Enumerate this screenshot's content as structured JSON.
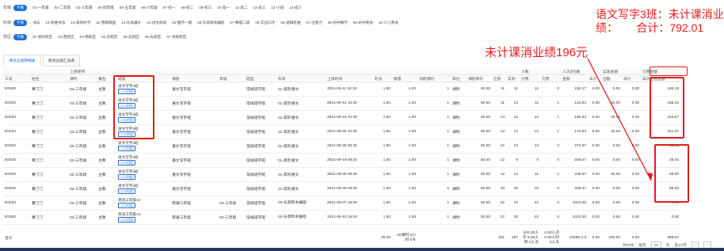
{
  "filters": [
    {
      "label": "年级:",
      "items": [
        "不限",
        "01-一年级",
        "02-二年级",
        "03-三年级",
        "04-四年级",
        "05-五年级",
        "06-六年级",
        "07-初一",
        "08-初二",
        "09-初三",
        "10-高一",
        "11-高二",
        "12-高三",
        "13-小班",
        "14-成人"
      ]
    },
    {
      "label": "科目:",
      "items": [
        "不限",
        "书法",
        "14-思维书法",
        "15-高效补学",
        "11-围棋棋盘",
        "13-乐高器片",
        "01-语文阅读",
        "02-国学一级",
        "03-乐高积木编程",
        "07-数理二级",
        "05-实战口才",
        "06-逻辑思维",
        "07-注意力",
        "08-初中数学",
        "09-初中英语",
        "10-少儿英语"
      ]
    },
    {
      "label": "校区:",
      "items": [
        "不限",
        "01-星科校区",
        "02-西校区",
        "03-南校区",
        "04-东校区",
        "05-北校区",
        "06-光校区",
        "07-洛阳校区"
      ]
    }
  ],
  "tabs": [
    "课消业绩明细表",
    "课消业绩汇总表"
  ],
  "headers_top": [
    "",
    "",
    "上课老师",
    "",
    "",
    "",
    "",
    "",
    "",
    "",
    "",
    "",
    "",
    "",
    "",
    "",
    "",
    "人数",
    "",
    "人次(时)数",
    "",
    "实收金额",
    "",
    "欠费金额",
    "",
    ""
  ],
  "headers": [
    "工号",
    "姓名",
    "课时",
    "角色",
    "班级",
    "课程",
    "年级",
    "班型",
    "科目",
    "上课时间",
    "时长",
    "数量",
    "消耗课时",
    "单位",
    "课程单价",
    "应到",
    "实到",
    "计费",
    "欠费",
    "金额",
    "未计",
    "出勤",
    "未计",
    "未计业绩金额"
  ],
  "rows": [
    {
      "id": "E0020",
      "name": "黄汀汀",
      "grade": "03-三年级",
      "role": "主教",
      "cls": "语文写字3班",
      "course": "语文写字班",
      "nj": "",
      "bx": "常规班学班",
      "km": "01-高阶语文",
      "time": "2021-09-11 10:30",
      "dur": "1.50",
      "qty": "1.00",
      "xh": "1",
      "unit": "课时",
      "price": "50.00",
      "yd": "11",
      "sd": "11",
      "jf": "11",
      "qf": "0",
      "je": "158.17",
      "wj": "0.00",
      "cq": "0.00",
      "wj2": "0.00",
      "perf": "188.33"
    },
    {
      "id": "E0020",
      "name": "黄汀汀",
      "grade": "03-三年级",
      "role": "主教",
      "cls": "语文写字3班",
      "course": "语文写字班",
      "nj": "",
      "bx": "常规班学班",
      "km": "01-高阶语文",
      "time": "2021-09-12 10:30",
      "dur": "1.50",
      "qty": "1.00",
      "xh": "1",
      "unit": "课时",
      "price": "50.00",
      "yd": "11",
      "sd": "12",
      "jf": "11",
      "qf": "1",
      "je": "134.83",
      "wj": "0.00",
      "cq": "25.00",
      "wj2": "0.00",
      "perf": "188.34"
    },
    {
      "id": "E0020",
      "name": "黄汀汀",
      "grade": "03-三年级",
      "role": "主教",
      "cls": "语文写字3班",
      "course": "语文写字班",
      "nj": "",
      "bx": "常规班学班",
      "km": "01-高阶语文",
      "time": "2021-09-19 10:30",
      "dur": "1.50",
      "qty": "1.00",
      "xh": "1",
      "unit": "课时",
      "price": "50.00",
      "yd": "13",
      "sd": "12",
      "jf": "12",
      "qf": "1",
      "je": "160.83",
      "wj": "0.00",
      "cq": "25.00",
      "wj2": "0.00",
      "perf": "153.67"
    },
    {
      "id": "E0020",
      "name": "黄汀汀",
      "grade": "03-三年级",
      "role": "主教",
      "cls": "语文写字3班",
      "course": "语文写字班",
      "nj": "",
      "bx": "常规班学班",
      "km": "01-高阶语文",
      "time": "2021-09-25 10:30",
      "dur": "1.50",
      "qty": "1.00",
      "xh": "1",
      "unit": "课时",
      "price": "50.00",
      "yd": "13",
      "sd": "12",
      "jf": "12",
      "qf": "1",
      "je": "174.83",
      "wj": "0.00",
      "cq": "25.00",
      "wj2": "0.00",
      "perf": "221.67"
    },
    {
      "id": "E0020",
      "name": "黄汀汀",
      "grade": "03-三年级",
      "role": "主教",
      "cls": "语文写字3班",
      "course": "语文写字班",
      "nj": "",
      "bx": "常规班学班",
      "km": "01-高阶语文",
      "time": "2021-09-26 08:30",
      "dur": "1.50",
      "qty": "1.00",
      "xh": "1",
      "unit": "课时",
      "price": "50.00",
      "yd": "12",
      "sd": "12",
      "jf": "12",
      "qf": "0",
      "je": "272.67",
      "wj": "0.00",
      "cq": "0.00",
      "wj2": "0.00",
      "perf": "56.00"
    },
    {
      "id": "E0020",
      "name": "黄汀汀",
      "grade": "03-三年级",
      "role": "主教",
      "cls": "语文写字3班",
      "course": "语文写字班",
      "nj": "",
      "bx": "常规班学班",
      "km": "01-高阶语文",
      "time": "2021-09-19 08:30",
      "dur": "1.50",
      "qty": "1.00",
      "xh": "1",
      "unit": "课时",
      "price": "50.00",
      "yd": "12",
      "sd": "9",
      "jf": "9",
      "qf": "0",
      "je": "208.67",
      "wj": "0.00",
      "cq": "0.00",
      "wj2": "0.00",
      "perf": "28.00"
    },
    {
      "id": "E0020",
      "name": "黄汀汀",
      "grade": "03-三年级",
      "role": "主教",
      "cls": "语文写字3班",
      "course": "语文写字班",
      "nj": "",
      "bx": "常规班学班",
      "km": "01-高阶语文",
      "time": "2021-09-25 08:30",
      "dur": "1.50",
      "qty": "1.00",
      "xh": "1",
      "unit": "课时",
      "price": "50.00",
      "yd": "12",
      "sd": "12",
      "jf": "11",
      "qf": "1",
      "je": "235.67",
      "wj": "0.00",
      "cq": "25.00",
      "wj2": "0.00",
      "perf": "56.00"
    },
    {
      "id": "E0020",
      "name": "黄汀汀",
      "grade": "03-三年级",
      "role": "主教",
      "cls": "语文写字3班",
      "course": "语文写字班",
      "nj": "",
      "bx": "常规班学班",
      "km": "01-高阶语文",
      "time": "2021-09-26 08:30",
      "dur": "1.50",
      "qty": "1.00",
      "xh": "1",
      "unit": "课时",
      "price": "50.00",
      "yd": "10",
      "sd": "10",
      "jf": "10",
      "qf": "0",
      "je": "205.67",
      "wj": "0.00",
      "cq": "0.00",
      "wj2": "0.00",
      "perf": "56.00"
    },
    {
      "id": "E0020",
      "name": "黄汀汀",
      "grade": "03-三年级",
      "role": "主教",
      "cls": "英语三年级A2",
      "course": "英语三年级",
      "nj": "03-三年级",
      "bx": "常规班学班",
      "km": "03-乐高积木编程",
      "time": "2021-09-07 19:00",
      "dur": "1.50",
      "qty": "1.00",
      "xh": "1",
      "unit": "课时",
      "price": "50.00",
      "yd": "22",
      "sd": "22",
      "jf": "22",
      "qf": "0",
      "je": "1022.00",
      "wj": "0.00",
      "cq": "0.00",
      "wj2": "0.00",
      "perf": "0.00"
    },
    {
      "id": "E0020",
      "name": "黄汀汀",
      "grade": "03-三年级",
      "role": "主教",
      "cls": "英语三年级A2",
      "course": "英语三年级",
      "nj": "03-三年级",
      "bx": "常规班学班",
      "km": "03-乐高积木编程",
      "time": "2021-09-10 19:00",
      "dur": "1.50",
      "qty": "1.00",
      "xh": "1",
      "unit": "课时",
      "price": "50.00",
      "yd": "22",
      "sd": "22",
      "jf": "22",
      "qf": "0",
      "je": "1022.00",
      "wj": "0.00",
      "cq": "0.00",
      "wj2": "0.00",
      "perf": "0.00"
    }
  ],
  "badge": "二小时班",
  "summary": {
    "label": "合计",
    "dur": "35.00",
    "qty": "20课时 5小时 0天",
    "xh": "",
    "yd": "301",
    "sd": "297",
    "jf": "202.00人次 5.00人时 0人天",
    "qf": "4.00人次 0.00人时 0人天",
    "je": "10286.3 3",
    "wj": "0.00",
    "cq": "100.00",
    "wj2": "0.00",
    "perf": "988.02"
  },
  "annotations": {
    "top_right": "语文写字3班：未计课消业绩：合计：792.01",
    "top_right_l1": "语文写字3班：未计课消业",
    "top_right_l2": "绩：      合计：792.01",
    "middle": "未计课消业绩196元"
  },
  "pager": {
    "total": "共25条",
    "per": "每页",
    "size": "10",
    "unit": "条",
    "page": "第1/3页"
  }
}
